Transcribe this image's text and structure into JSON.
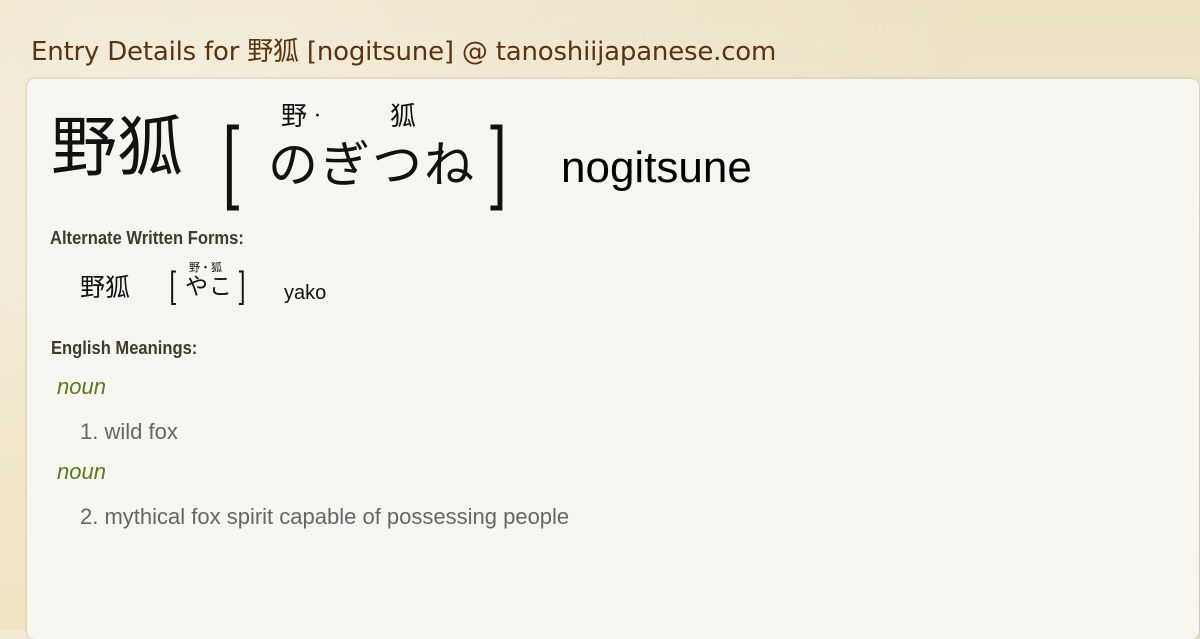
{
  "page": {
    "title": "Entry Details for 野狐 [nogitsune] @ tanoshiijapanese.com"
  },
  "entry": {
    "kanji": "野狐",
    "bracket_open": "[",
    "bracket_close": "]",
    "furigana": [
      "野",
      "狐"
    ],
    "furigana_separator": "·",
    "kana": "のぎつね",
    "romaji": "nogitsune"
  },
  "alternate_forms": {
    "heading": "Alternate Written Forms:",
    "items": [
      {
        "kanji": "野狐",
        "furigana": "野・狐",
        "kana": "やこ",
        "romaji": "yako"
      }
    ]
  },
  "meanings": {
    "heading": "English Meanings:",
    "items": [
      {
        "pos": "noun",
        "text": "1. wild fox"
      },
      {
        "pos": "noun",
        "text": "2. mythical fox spirit capable of possessing people"
      }
    ]
  },
  "colors": {
    "title": "#5a3310",
    "part_of_speech": "#587a20",
    "meaning_text": "#666666",
    "heading": "#3d3d2a",
    "card_background": "#f7f5f0"
  }
}
